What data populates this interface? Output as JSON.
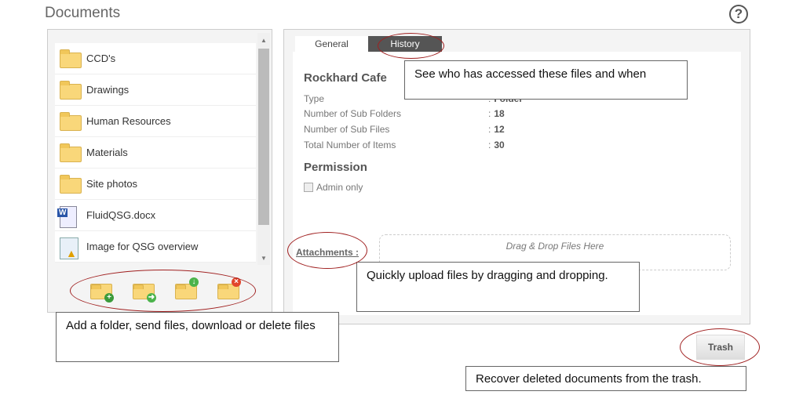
{
  "header": {
    "title": "Documents",
    "help_icon": "help-circle-icon"
  },
  "file_list": [
    {
      "name": "CCD's",
      "icon": "folder-icon"
    },
    {
      "name": "Drawings",
      "icon": "folder-icon"
    },
    {
      "name": "Human Resources",
      "icon": "folder-icon"
    },
    {
      "name": "Materials",
      "icon": "folder-icon"
    },
    {
      "name": "Site photos",
      "icon": "folder-icon"
    },
    {
      "name": "FluidQSG.docx",
      "icon": "word-doc-icon"
    },
    {
      "name": "Image for QSG overview",
      "icon": "image-warning-icon"
    }
  ],
  "toolbar": [
    "add-folder-icon",
    "send-files-icon",
    "download-icon",
    "delete-icon"
  ],
  "tabs": [
    {
      "label": "General"
    },
    {
      "label": "History"
    }
  ],
  "details": {
    "name": "Rockhard Cafe",
    "fields": [
      {
        "label": "Type",
        "value": "Folder"
      },
      {
        "label": "Number of Sub Folders",
        "value": "18"
      },
      {
        "label": "Number of Sub Files",
        "value": "12"
      },
      {
        "label": "Total Number of Items",
        "value": "30"
      }
    ],
    "permission_heading": "Permission",
    "admin_only": "Admin only",
    "admin_only_checked": false,
    "attachments_label": "Attachments :",
    "drop_text": "Drag & Drop Files Here"
  },
  "trash_label": "Trash",
  "callouts": {
    "history": "See who has accessed these files and when",
    "upload": "Quickly upload files by dragging and dropping.",
    "toolbar": "Add a folder, send files, download or delete files",
    "trash": "Recover deleted documents from the trash."
  },
  "colors": {
    "annotation_oval": "#a02020",
    "history_tab": "#555555"
  }
}
